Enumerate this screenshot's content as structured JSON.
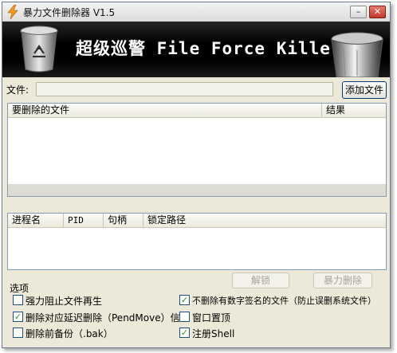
{
  "window": {
    "title": "暴力文件删除器 V1.5",
    "minimize_glyph": "–",
    "close_glyph": "✕"
  },
  "banner": {
    "text": "超级巡警 File Force Killer"
  },
  "file_row": {
    "label": "文件:",
    "input_value": "",
    "add_button": "添加文件"
  },
  "files_list": {
    "columns": [
      "要删除的文件",
      "结果"
    ],
    "rows": []
  },
  "process_list": {
    "columns": [
      "进程名",
      "PID",
      "句柄",
      "锁定路径"
    ],
    "rows": []
  },
  "actions": {
    "unlock_button": "解锁",
    "force_delete_button": "暴力删除"
  },
  "options": {
    "group_label": "选项",
    "items": [
      {
        "label": "强力阻止文件再生",
        "checked": false
      },
      {
        "label": "不删除有数字签名的文件（防止误删系统文件）",
        "checked": true
      },
      {
        "label": "删除对应延迟删除（PendMove）信息",
        "checked": true
      },
      {
        "label": "窗口置顶",
        "checked": false
      },
      {
        "label": "删除前备份（.bak）",
        "checked": false
      },
      {
        "label": "注册Shell",
        "checked": true
      }
    ]
  },
  "icons": [
    "lightning-icon",
    "recycle-bin-icon",
    "trash-can-icon"
  ],
  "colors": {
    "banner_bg": "#000000",
    "window_bg": "#ece9d8",
    "close_btn": "#c3372a",
    "checkmark": "#21a121"
  }
}
